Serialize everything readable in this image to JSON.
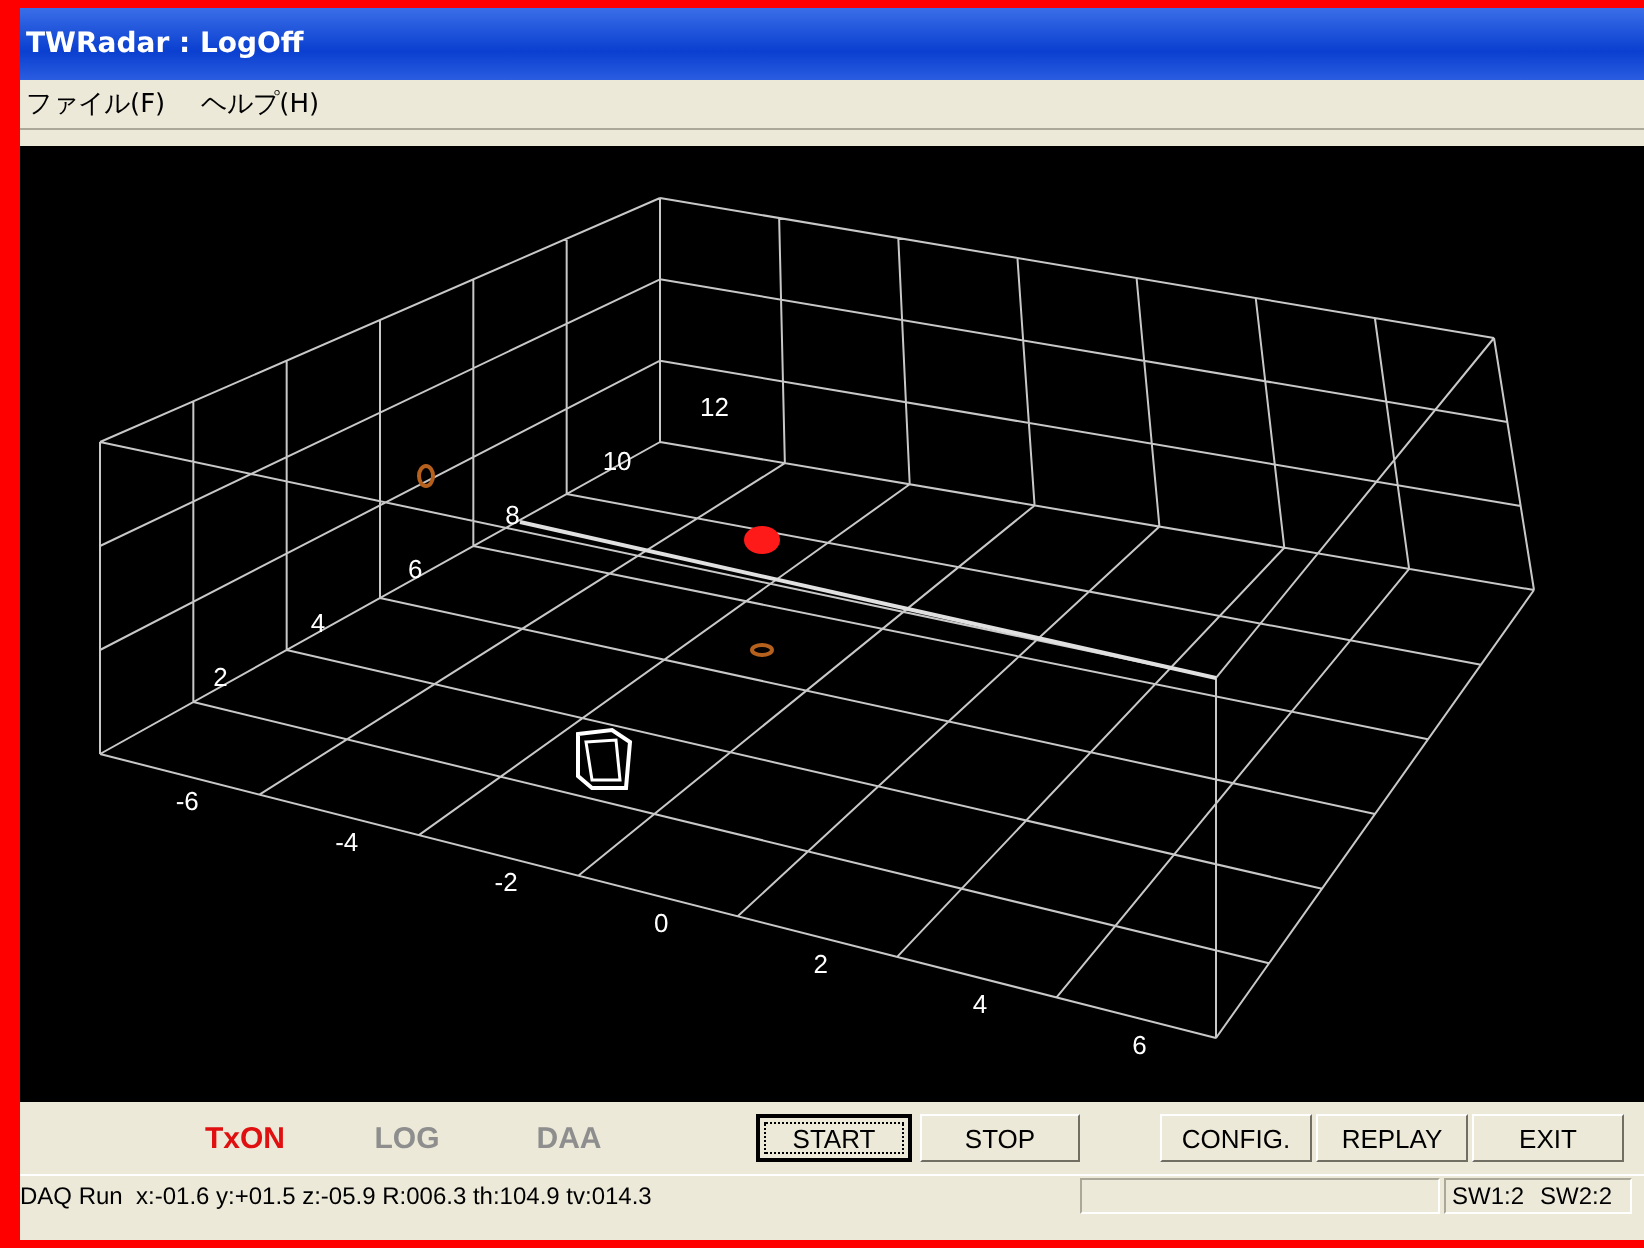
{
  "window": {
    "title": "TWRadar : LogOff"
  },
  "menu": [
    "ファイル(F)",
    "ヘルプ(H)"
  ],
  "scene": {
    "depth_labels": [
      "2",
      "4",
      "6",
      "8",
      "10",
      "12"
    ],
    "width_labels": [
      "-6",
      "-4",
      "-2",
      "0",
      "2",
      "4",
      "6"
    ]
  },
  "indicators": [
    {
      "label": "TxON",
      "on": true
    },
    {
      "label": "LOG",
      "on": false
    },
    {
      "label": "DAA",
      "on": false
    }
  ],
  "buttons": [
    {
      "label": "START",
      "selected": true
    },
    {
      "label": "STOP",
      "selected": false
    }
  ],
  "right_buttons": [
    {
      "label": "CONFIG.",
      "selected": false
    },
    {
      "label": "REPLAY",
      "selected": false
    },
    {
      "label": "EXIT",
      "selected": false
    }
  ],
  "status_bar": {
    "text": "DAQ Run  x:-01.6 y:+01.5 z:-05.9 R:006.3 th:104.9 tv:014.3",
    "switches": [
      "SW1:2",
      "SW2:2"
    ]
  }
}
